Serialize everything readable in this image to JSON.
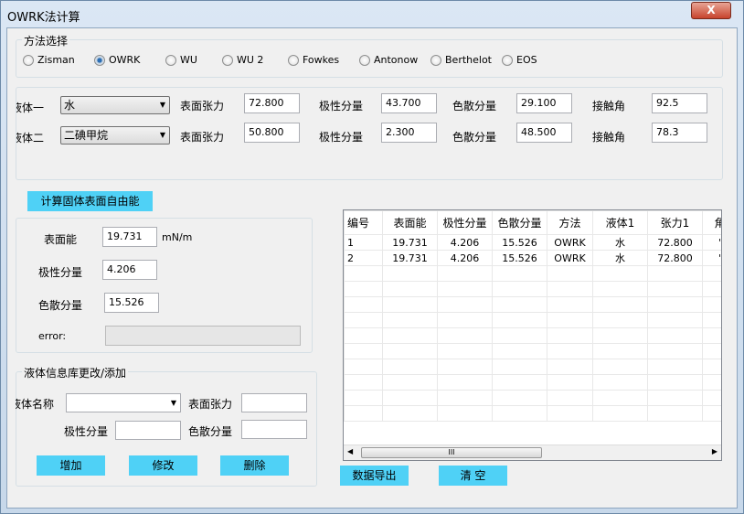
{
  "window": {
    "title": "OWRK法计算",
    "close": "X"
  },
  "method": {
    "label": "方法选择",
    "options": [
      "Zisman",
      "OWRK",
      "WU",
      "WU 2",
      "Fowkes",
      "Antonow",
      "Berthelot",
      "EOS"
    ],
    "selected": "OWRK"
  },
  "liquid1": {
    "label": "液体一",
    "name": "水",
    "tension_label": "表面张力",
    "tension": "72.800",
    "polar_label": "极性分量",
    "polar": "43.700",
    "disp_label": "色散分量",
    "disp": "29.100",
    "angle_label": "接触角",
    "angle": "92.5"
  },
  "liquid2": {
    "label": "液体二",
    "name": "二碘甲烷",
    "tension_label": "表面张力",
    "tension": "50.800",
    "polar_label": "极性分量",
    "polar": "2.300",
    "disp_label": "色散分量",
    "disp": "48.500",
    "angle_label": "接触角",
    "angle": "78.3"
  },
  "calc_button": "计算固体表面自由能",
  "result": {
    "energy_label": "表面能",
    "energy": "19.731",
    "unit": "mN/m",
    "polar_label": "极性分量",
    "polar": "4.206",
    "disp_label": "色散分量",
    "disp": "15.526",
    "error_label": "error:",
    "error": ""
  },
  "db": {
    "label": "液体信息库更改/添加",
    "name_label": "液体名称",
    "name": "",
    "tension_label": "表面张力",
    "tension": "",
    "polar_label": "极性分量",
    "polar": "",
    "disp_label": "色散分量",
    "disp": "",
    "add": "增加",
    "edit": "修改",
    "delete": "删除"
  },
  "table": {
    "headers": [
      "编号",
      "表面能",
      "极性分量",
      "色散分量",
      "方法",
      "液体1",
      "张力1",
      "角"
    ],
    "rows": [
      [
        "1",
        "19.731",
        "4.206",
        "15.526",
        "OWRK",
        "水",
        "72.800",
        "'"
      ],
      [
        "2",
        "19.731",
        "4.206",
        "15.526",
        "OWRK",
        "水",
        "72.800",
        "'"
      ]
    ],
    "scroll_thumb": "III"
  },
  "export_button": "数据导出",
  "clear_button": "清 空"
}
